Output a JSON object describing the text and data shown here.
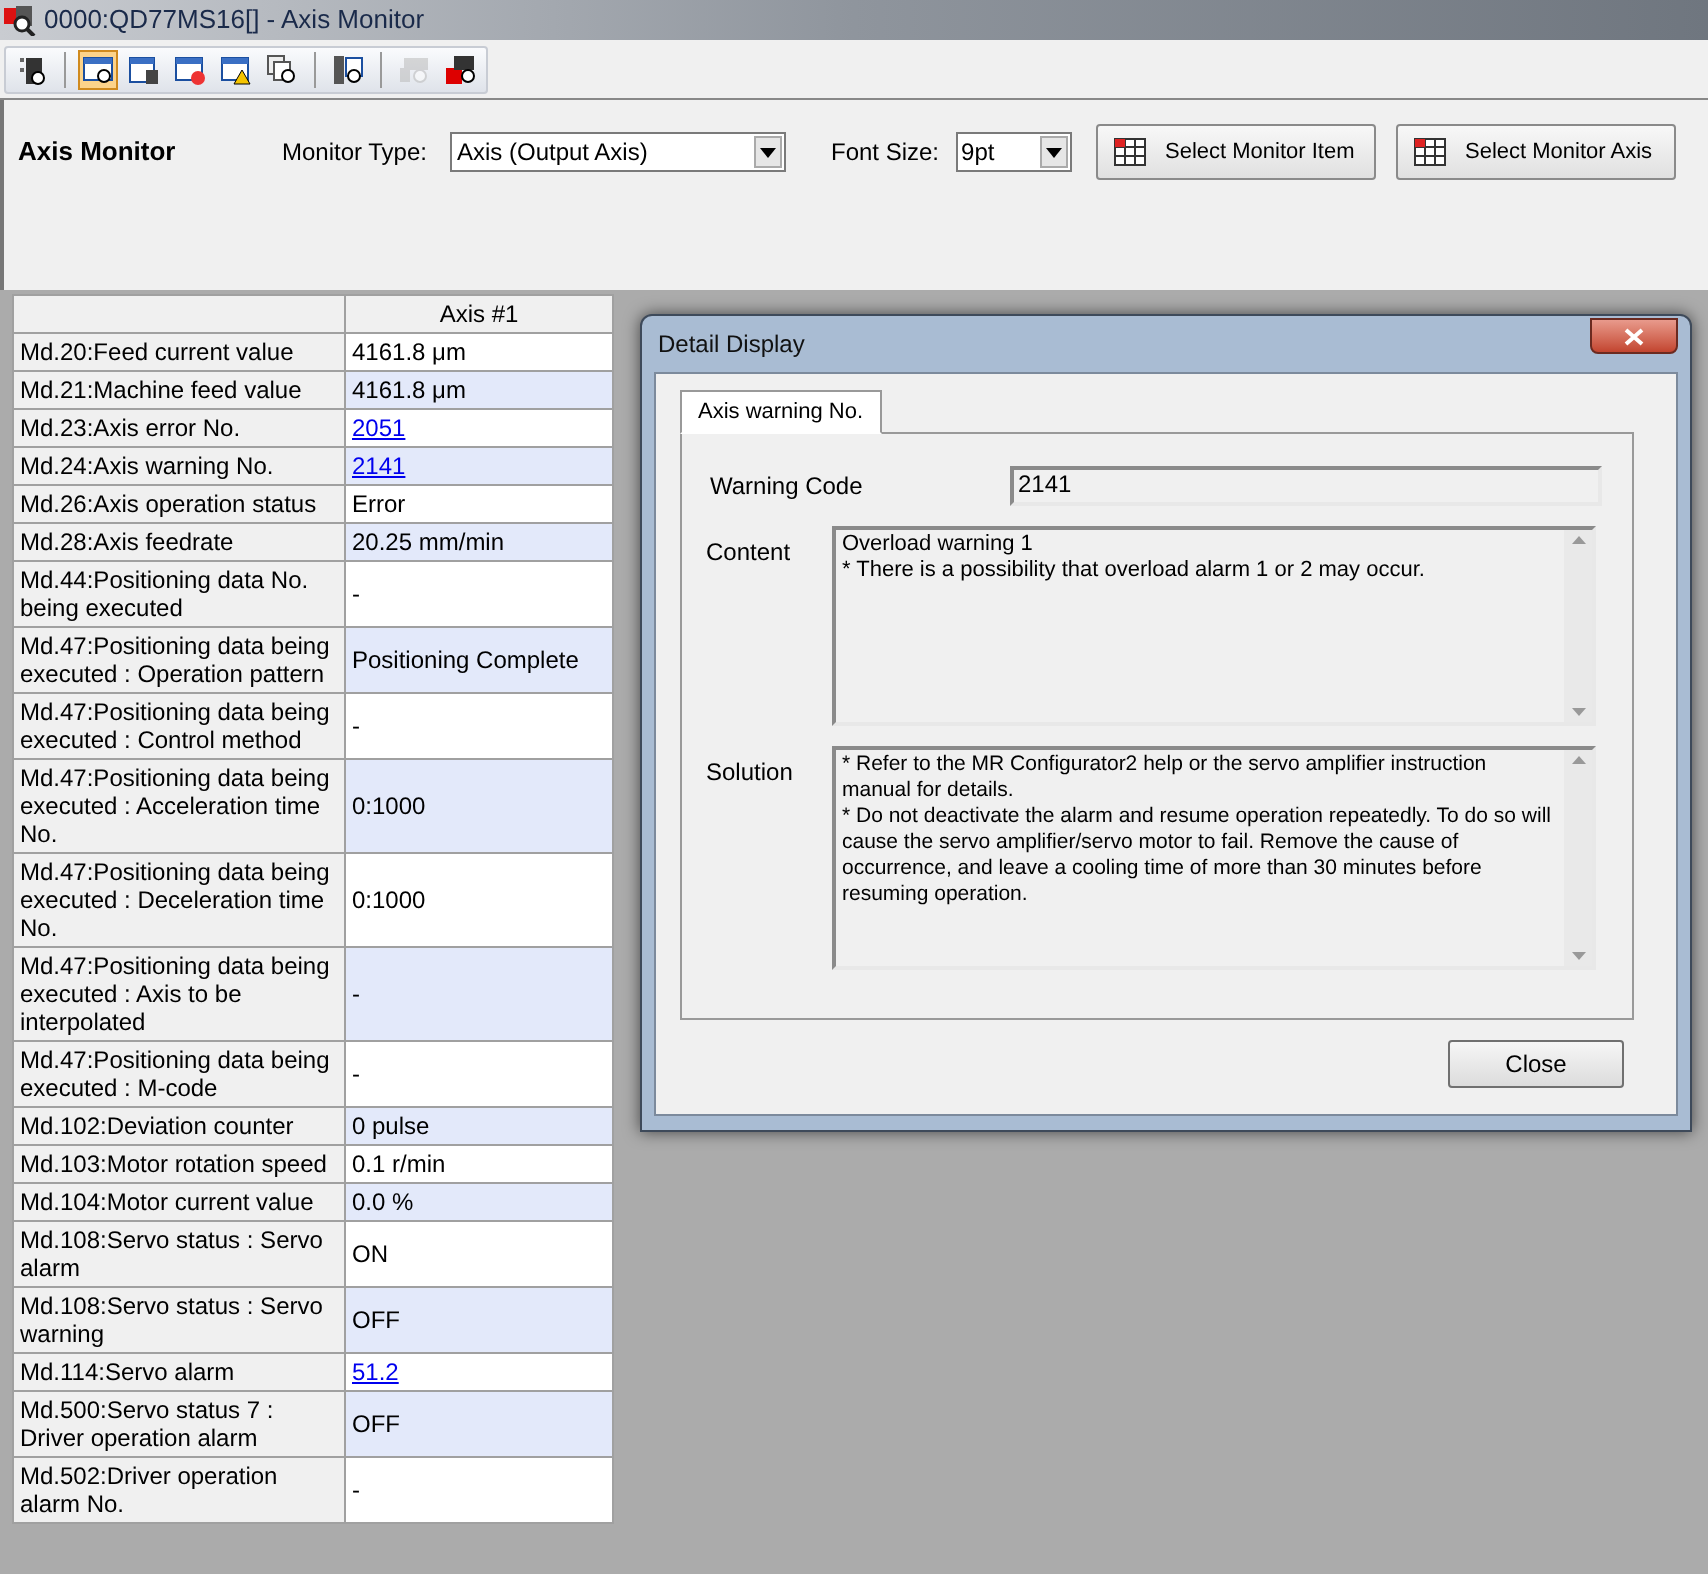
{
  "window": {
    "title": "0000:QD77MS16[] - Axis Monitor"
  },
  "toolbar": [
    {
      "selected": false,
      "disabled": false
    },
    {
      "selected": true,
      "disabled": false
    },
    {
      "selected": false,
      "disabled": false
    },
    {
      "selected": false,
      "disabled": false
    },
    {
      "selected": false,
      "disabled": false
    },
    {
      "selected": false,
      "disabled": false
    },
    {
      "selected": false,
      "disabled": false
    },
    {
      "selected": false,
      "disabled": true
    },
    {
      "selected": false,
      "disabled": false
    }
  ],
  "header": {
    "title": "Axis Monitor",
    "monitor_type_label": "Monitor Type:",
    "monitor_type": "Axis (Output Axis)",
    "font_size_label": "Font Size:",
    "font_size": "9pt",
    "buttons": [
      "Select Monitor Item",
      "Select Monitor Axis"
    ]
  },
  "table": {
    "columns": [
      "Axis #1"
    ],
    "rows": [
      {
        "item": "Md.20:Feed current value",
        "value": "4161.8 μm",
        "link": false
      },
      {
        "item": "Md.21:Machine feed value",
        "value": "4161.8 μm",
        "link": false
      },
      {
        "item": "Md.23:Axis error No.",
        "value": "2051",
        "link": true
      },
      {
        "item": "Md.24:Axis warning No.",
        "value": "2141",
        "link": true
      },
      {
        "item": "Md.26:Axis operation status",
        "value": "Error",
        "link": false
      },
      {
        "item": "Md.28:Axis feedrate",
        "value": "20.25 mm/min",
        "link": false
      },
      {
        "item": "Md.44:Positioning data No. being executed",
        "value": "-",
        "link": false
      },
      {
        "item": "Md.47:Positioning data being executed : Operation pattern",
        "value": "Positioning Complete",
        "link": false
      },
      {
        "item": "Md.47:Positioning data being executed : Control method",
        "value": "-",
        "link": false
      },
      {
        "item": "Md.47:Positioning data being executed : Acceleration time No.",
        "value": "0:1000",
        "link": false
      },
      {
        "item": "Md.47:Positioning data being executed : Deceleration time No.",
        "value": "0:1000",
        "link": false
      },
      {
        "item": "Md.47:Positioning data being executed : Axis to be interpolated",
        "value": "-",
        "link": false
      },
      {
        "item": "Md.47:Positioning data being executed : M-code",
        "value": "-",
        "link": false
      },
      {
        "item": "Md.102:Deviation counter",
        "value": "0 pulse",
        "link": false
      },
      {
        "item": "Md.103:Motor rotation speed",
        "value": "0.1 r/min",
        "link": false
      },
      {
        "item": "Md.104:Motor current value",
        "value": "0.0 %",
        "link": false
      },
      {
        "item": "Md.108:Servo status : Servo alarm",
        "value": "ON",
        "link": false
      },
      {
        "item": "Md.108:Servo status : Servo warning",
        "value": "OFF",
        "link": false
      },
      {
        "item": "Md.114:Servo alarm",
        "value": "51.2",
        "link": true
      },
      {
        "item": "Md.500:Servo status 7 : Driver operation alarm",
        "value": "OFF",
        "link": false
      },
      {
        "item": "Md.502:Driver operation alarm No.",
        "value": "-",
        "link": false
      }
    ]
  },
  "dialog": {
    "title": "Detail Display",
    "tabs": [
      {
        "label": "Axis warning No.",
        "selected": true
      }
    ],
    "code_label": "Warning Code",
    "code": "2141",
    "content_label": "Content",
    "content": "Overload warning 1\n* There is a possibility that overload alarm 1 or 2 may occur.",
    "solution_label": "Solution",
    "solution": "* Refer to the MR Configurator2 help or the servo amplifier instruction manual for details.\n* Do not deactivate the alarm and resume operation repeatedly. To do so will cause the servo amplifier/servo motor to fail. Remove the cause of occurrence, and leave a cooling time of more than 30 minutes before resuming operation.",
    "close_button": "Close"
  }
}
